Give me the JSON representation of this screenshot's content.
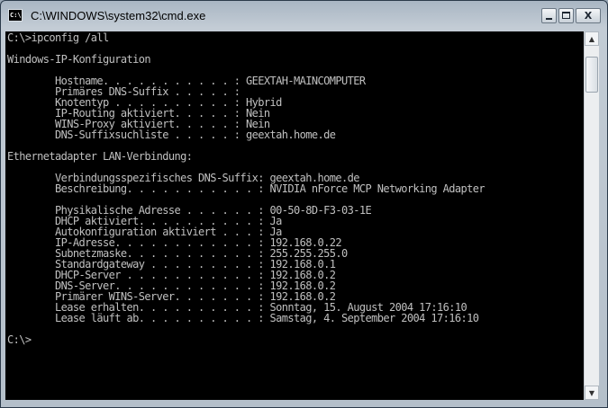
{
  "window": {
    "title": "C:\\WINDOWS\\system32\\cmd.exe",
    "icon_text": "C:\\",
    "controls": {
      "minimize": "minimize",
      "maximize": "maximize",
      "close": "X"
    }
  },
  "console": {
    "lines": [
      "C:\\>ipconfig /all",
      "",
      "Windows-IP-Konfiguration",
      "",
      "        Hostname. . . . . . . . . . . : GEEXTAH-MAINCOMPUTER",
      "        Primäres DNS-Suffix . . . . . :",
      "        Knotentyp . . . . . . . . . . : Hybrid",
      "        IP-Routing aktiviert. . . . . : Nein",
      "        WINS-Proxy aktiviert. . . . . : Nein",
      "        DNS-Suffixsuchliste . . . . . : geextah.home.de",
      "",
      "Ethernetadapter LAN-Verbindung:",
      "",
      "        Verbindungsspezifisches DNS-Suffix: geextah.home.de",
      "        Beschreibung. . . . . . . . . . . : NVIDIA nForce MCP Networking Adapter",
      "",
      "        Physikalische Adresse . . . . . . : 00-50-8D-F3-03-1E",
      "        DHCP aktiviert. . . . . . . . . . : Ja",
      "        Autokonfiguration aktiviert . . . : Ja",
      "        IP-Adresse. . . . . . . . . . . . : 192.168.0.22",
      "        Subnetzmaske. . . . . . . . . . . : 255.255.255.0",
      "        Standardgateway . . . . . . . . . : 192.168.0.1",
      "        DHCP-Server . . . . . . . . . . . : 192.168.0.2",
      "        DNS-Server. . . . . . . . . . . . : 192.168.0.2",
      "        Primärer WINS-Server. . . . . . . : 192.168.0.2",
      "        Lease erhalten. . . . . . . . . . : Sonntag, 15. August 2004 17:16:10",
      "        Lease läuft ab. . . . . . . . . . : Samstag, 4. September 2004 17:16:10",
      "",
      "C:\\>"
    ]
  },
  "scrollbar": {
    "up_arrow": "▲",
    "down_arrow": "▼"
  },
  "colors": {
    "console_bg": "#000000",
    "console_text": "#c0c0c0"
  }
}
